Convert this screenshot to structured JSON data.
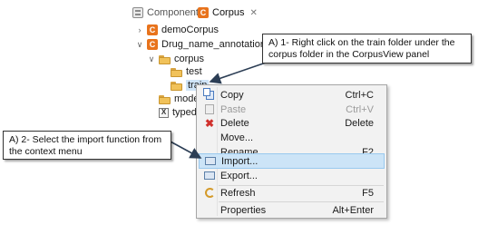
{
  "tabs": {
    "component_label": "Component",
    "corpus_label": "Corpus",
    "close_glyph": "✕",
    "corpus_icon_letter": "C"
  },
  "tree": {
    "items": [
      {
        "label": "demoCorpus",
        "expanded": false
      },
      {
        "label": "Drug_name_annotation",
        "expanded": true
      },
      {
        "label": "corpus",
        "expanded": true
      },
      {
        "label": "test"
      },
      {
        "label": "train",
        "selected": true
      },
      {
        "label": "model"
      },
      {
        "label": "typede"
      }
    ],
    "c_icon_letter": "C",
    "x_icon_letter": "X"
  },
  "callouts": {
    "right_click": "A) 1- Right click on the train folder under the corpus folder in the CorpusView  panel",
    "import_step": "A) 2- Select the import function from the context menu"
  },
  "context_menu": {
    "items": [
      {
        "label": "Copy",
        "shortcut": "Ctrl+C",
        "icon": "copy-icon"
      },
      {
        "label": "Paste",
        "shortcut": "Ctrl+V",
        "icon": "paste-icon",
        "disabled": true
      },
      {
        "label": "Delete",
        "shortcut": "Delete",
        "icon": "delete-icon"
      },
      {
        "label": "Move...",
        "shortcut": ""
      },
      {
        "label": "Rename...",
        "shortcut": "F2"
      },
      {
        "label": "Import...",
        "shortcut": "",
        "icon": "import-icon",
        "highlighted": true
      },
      {
        "label": "Export...",
        "shortcut": "",
        "icon": "export-icon"
      },
      {
        "label": "Refresh",
        "shortcut": "F5",
        "icon": "refresh-icon"
      },
      {
        "label": "Properties",
        "shortcut": "Alt+Enter"
      }
    ]
  },
  "colors": {
    "highlight": "#cce4f7",
    "selection": "#cfe4f7",
    "corpus_icon": "#e8731c",
    "delete_icon": "#d0312d"
  }
}
